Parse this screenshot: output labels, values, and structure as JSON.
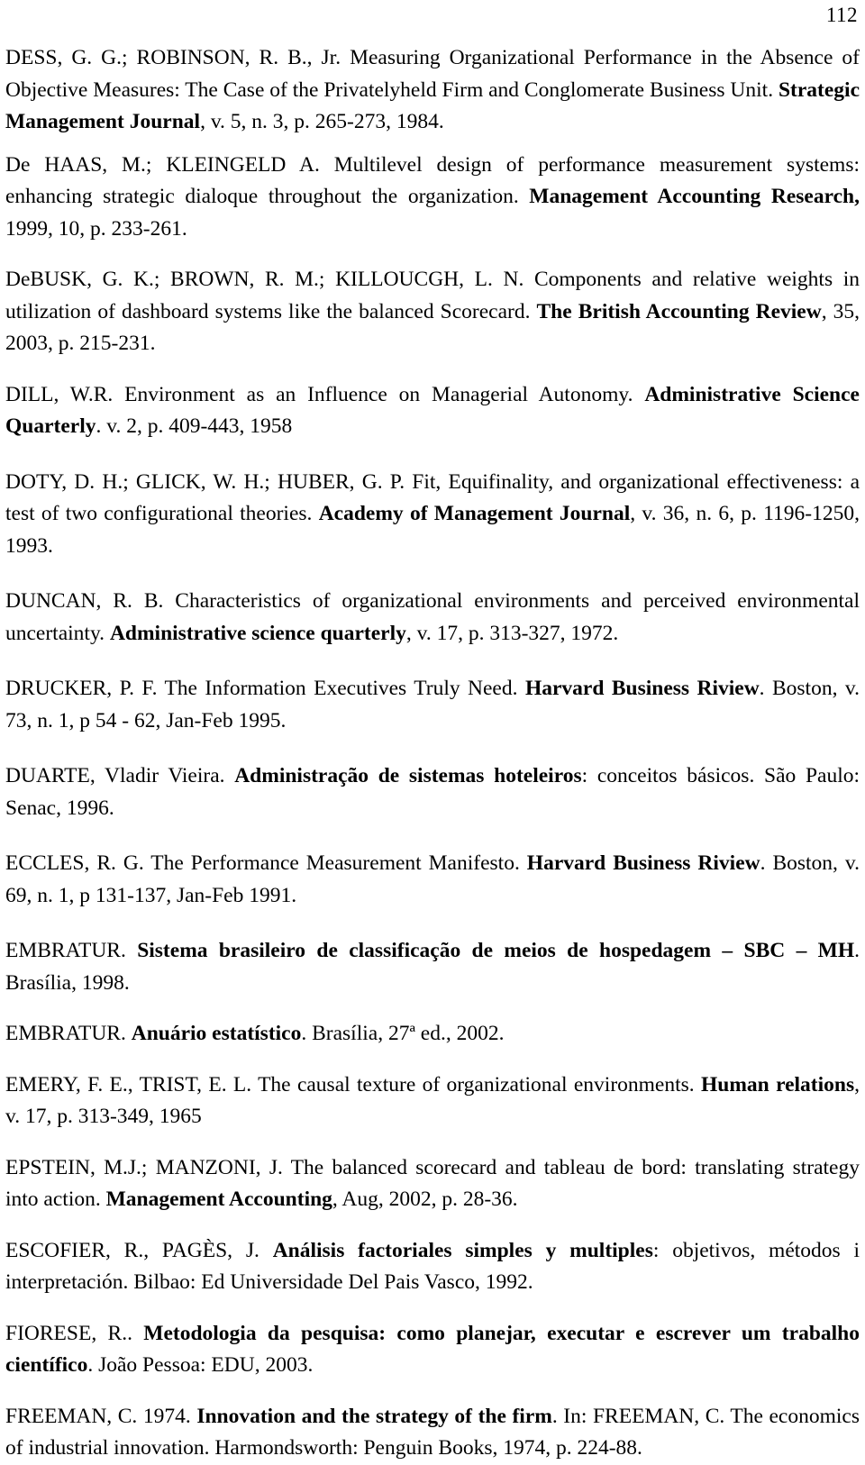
{
  "page": {
    "number": "112",
    "title_visible": false
  },
  "references": [
    {
      "id": "dess-robinson",
      "gap": "gap-s",
      "segments": [
        {
          "t": "DESS, G. G.; ROBINSON, R. B., Jr. Measuring Organizational Performance in the Absence of Objective Measures: The Case of the Privatelyheld Firm and Conglomerate Business Unit. ",
          "b": false
        },
        {
          "t": "Strategic Management Journal",
          "b": true
        },
        {
          "t": ", v. 5, n. 3, p. 265-273, 1984.",
          "b": false
        }
      ]
    },
    {
      "id": "de-haas-kleingeld",
      "gap": "gap-m",
      "segments": [
        {
          "t": "De HAAS, M.; KLEINGELD A. Multilevel design of performance measurement systems: enhancing strategic dialoque throughout the organization. ",
          "b": false
        },
        {
          "t": "Management Accounting Research,",
          "b": true
        },
        {
          "t": " 1999, 10, p. 233-261.",
          "b": false
        }
      ]
    },
    {
      "id": "debusk-brown-killoucgh",
      "gap": "gap-m",
      "segments": [
        {
          "t": "DeBUSK, G. K.; BROWN, R. M.; KILLOUCGH, L. N. Components and relative weights in utilization of dashboard systems like the balanced Scorecard. ",
          "b": false
        },
        {
          "t": "The British Accounting Review",
          "b": true
        },
        {
          "t": ", 35, 2003, p. 215-231.",
          "b": false
        }
      ]
    },
    {
      "id": "dill",
      "gap": "gap-l",
      "segments": [
        {
          "t": "DILL, W.R. Environment as an Influence on Managerial Autonomy. ",
          "b": false
        },
        {
          "t": "Administrative Science Quarterly",
          "b": true
        },
        {
          "t": ". v. 2, p. 409-443, 1958",
          "b": false
        }
      ]
    },
    {
      "id": "doty-glick-huber",
      "gap": "gap-l",
      "segments": [
        {
          "t": "DOTY, D. H.; GLICK, W. H.; HUBER, G. P. Fit, Equifinality, and organizational effectiveness: a test of two configurational theories. ",
          "b": false
        },
        {
          "t": "Academy of Management Journal",
          "b": true
        },
        {
          "t": ", v. 36, n. 6, p. 1196-1250, 1993.",
          "b": false
        }
      ]
    },
    {
      "id": "duncan",
      "gap": "gap-l",
      "segments": [
        {
          "t": "DUNCAN, R. B. Characteristics of organizational environments and perceived environmental uncertainty. ",
          "b": false
        },
        {
          "t": "Administrative science quarterly",
          "b": true
        },
        {
          "t": ", v. 17, p. 313-327, 1972.",
          "b": false
        }
      ]
    },
    {
      "id": "drucker",
      "gap": "gap-l",
      "segments": [
        {
          "t": "DRUCKER, P. F. The Information Executives Truly Need. ",
          "b": false
        },
        {
          "t": "Harvard Business Riview",
          "b": true
        },
        {
          "t": ". Boston, v. 73, n. 1, p 54 - 62, Jan-Feb 1995.",
          "b": false
        }
      ]
    },
    {
      "id": "duarte",
      "gap": "gap-l",
      "segments": [
        {
          "t": "DUARTE, Vladir Vieira. ",
          "b": false
        },
        {
          "t": "Administração de sistemas hoteleiros",
          "b": true
        },
        {
          "t": ": conceitos básicos. São Paulo: Senac, 1996.",
          "b": false
        }
      ]
    },
    {
      "id": "eccles",
      "gap": "gap-l",
      "segments": [
        {
          "t": "ECCLES, R. G. The Performance Measurement Manifesto. ",
          "b": false
        },
        {
          "t": "Harvard Business Riview",
          "b": true
        },
        {
          "t": ". Boston, v. 69, n. 1, p 131-137, Jan-Feb 1991.",
          "b": false
        }
      ]
    },
    {
      "id": "embratur-sbc",
      "gap": "gap-m",
      "segments": [
        {
          "t": "EMBRATUR. ",
          "b": false
        },
        {
          "t": "Sistema brasileiro de classificação de meios de hospedagem – SBC – MH",
          "b": true
        },
        {
          "t": ". Brasília, 1998.",
          "b": false
        }
      ]
    },
    {
      "id": "embratur-anuario",
      "gap": "gap-m",
      "segments": [
        {
          "t": "EMBRATUR.  ",
          "b": false
        },
        {
          "t": "Anuário estatístico",
          "b": true
        },
        {
          "t": ". Brasília, 27ª ed., 2002.",
          "b": false
        }
      ]
    },
    {
      "id": "emery-trist",
      "gap": "gap-m",
      "segments": [
        {
          "t": "EMERY, F. E., TRIST, E. L. The causal texture of organizational environments. ",
          "b": false
        },
        {
          "t": "Human relations",
          "b": true
        },
        {
          "t": ", v. 17, p. 313-349, 1965",
          "b": false
        }
      ]
    },
    {
      "id": "epstein-manzoni",
      "gap": "gap-m",
      "segments": [
        {
          "t": "EPSTEIN, M.J.; MANZONI, J. The balanced scorecard and tableau de bord: translating strategy into action. ",
          "b": false
        },
        {
          "t": "Management Accounting",
          "b": true
        },
        {
          "t": ", Aug, 2002, p. 28-36.",
          "b": false
        }
      ]
    },
    {
      "id": "escofier-pages",
      "gap": "gap-m",
      "segments": [
        {
          "t": "ESCOFIER, R., PAGÈS, J. ",
          "b": false
        },
        {
          "t": "Análisis factoriales simples y multiples",
          "b": true
        },
        {
          "t": ": objetivos, métodos i interpretación. Bilbao: Ed Universidade Del Pais Vasco, 1992.",
          "b": false
        }
      ]
    },
    {
      "id": "fiorese",
      "gap": "gap-m",
      "segments": [
        {
          "t": "FIORESE, R.. ",
          "b": false
        },
        {
          "t": "Metodologia da pesquisa: como planejar, executar e escrever um trabalho científico",
          "b": true
        },
        {
          "t": ". João Pessoa: EDU, 2003.",
          "b": false
        }
      ]
    },
    {
      "id": "freeman",
      "gap": "gap-0",
      "segments": [
        {
          "t": "FREEMAN, C. 1974. ",
          "b": false
        },
        {
          "t": "Innovation and the strategy of the firm",
          "b": true
        },
        {
          "t": ". In: FREEMAN, C. The economics of industrial innovation. Harmondsworth: Penguin Books, 1974, p. 224-88.",
          "b": false
        }
      ]
    }
  ]
}
